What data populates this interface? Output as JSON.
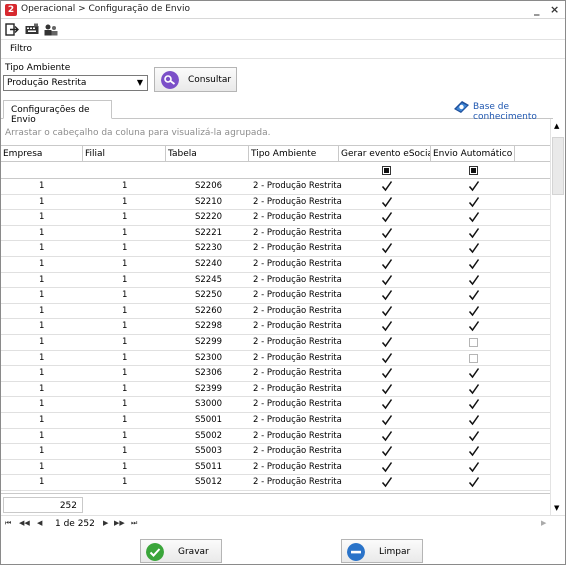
{
  "window": {
    "title": "Operacional > Configuração de Envio",
    "minimize": "_",
    "close": "×",
    "app_icon_glyph": "2"
  },
  "toolbar": {
    "icons": [
      "exit-icon",
      "keyboard-icon",
      "users-icon"
    ]
  },
  "filter": {
    "label": "Filtro",
    "tipo_ambiente_label": "Tipo Ambiente",
    "tipo_ambiente_value": "Produção Restrita",
    "consultar_label": "Consultar"
  },
  "tabs": [
    {
      "label": "Configurações de Envio",
      "active": true
    }
  ],
  "base_conhecimento": "Base de conhecimento",
  "grid": {
    "group_hint": "Arrastar o cabeçalho da coluna para visualizá-la agrupada.",
    "columns": [
      "Empresa",
      "Filial",
      "Tabela",
      "Tipo Ambiente",
      "Gerar evento eSocial",
      "Envio Automático"
    ],
    "rows": [
      {
        "empresa": "1",
        "filial": "1",
        "tabela": "S2206",
        "tipo": "2 - Produção Restrita",
        "gerar": true,
        "envio": true
      },
      {
        "empresa": "1",
        "filial": "1",
        "tabela": "S2210",
        "tipo": "2 - Produção Restrita",
        "gerar": true,
        "envio": true
      },
      {
        "empresa": "1",
        "filial": "1",
        "tabela": "S2220",
        "tipo": "2 - Produção Restrita",
        "gerar": true,
        "envio": true
      },
      {
        "empresa": "1",
        "filial": "1",
        "tabela": "S2221",
        "tipo": "2 - Produção Restrita",
        "gerar": true,
        "envio": true
      },
      {
        "empresa": "1",
        "filial": "1",
        "tabela": "S2230",
        "tipo": "2 - Produção Restrita",
        "gerar": true,
        "envio": true
      },
      {
        "empresa": "1",
        "filial": "1",
        "tabela": "S2240",
        "tipo": "2 - Produção Restrita",
        "gerar": true,
        "envio": true
      },
      {
        "empresa": "1",
        "filial": "1",
        "tabela": "S2245",
        "tipo": "2 - Produção Restrita",
        "gerar": true,
        "envio": true
      },
      {
        "empresa": "1",
        "filial": "1",
        "tabela": "S2250",
        "tipo": "2 - Produção Restrita",
        "gerar": true,
        "envio": true
      },
      {
        "empresa": "1",
        "filial": "1",
        "tabela": "S2260",
        "tipo": "2 - Produção Restrita",
        "gerar": true,
        "envio": true
      },
      {
        "empresa": "1",
        "filial": "1",
        "tabela": "S2298",
        "tipo": "2 - Produção Restrita",
        "gerar": true,
        "envio": true
      },
      {
        "empresa": "1",
        "filial": "1",
        "tabela": "S2299",
        "tipo": "2 - Produção Restrita",
        "gerar": true,
        "envio": false
      },
      {
        "empresa": "1",
        "filial": "1",
        "tabela": "S2300",
        "tipo": "2 - Produção Restrita",
        "gerar": true,
        "envio": false
      },
      {
        "empresa": "1",
        "filial": "1",
        "tabela": "S2306",
        "tipo": "2 - Produção Restrita",
        "gerar": true,
        "envio": true
      },
      {
        "empresa": "1",
        "filial": "1",
        "tabela": "S2399",
        "tipo": "2 - Produção Restrita",
        "gerar": true,
        "envio": true
      },
      {
        "empresa": "1",
        "filial": "1",
        "tabela": "S3000",
        "tipo": "2 - Produção Restrita",
        "gerar": true,
        "envio": true
      },
      {
        "empresa": "1",
        "filial": "1",
        "tabela": "S5001",
        "tipo": "2 - Produção Restrita",
        "gerar": true,
        "envio": true
      },
      {
        "empresa": "1",
        "filial": "1",
        "tabela": "S5002",
        "tipo": "2 - Produção Restrita",
        "gerar": true,
        "envio": true
      },
      {
        "empresa": "1",
        "filial": "1",
        "tabela": "S5003",
        "tipo": "2 - Produção Restrita",
        "gerar": true,
        "envio": true
      },
      {
        "empresa": "1",
        "filial": "1",
        "tabela": "S5011",
        "tipo": "2 - Produção Restrita",
        "gerar": true,
        "envio": true
      },
      {
        "empresa": "1",
        "filial": "1",
        "tabela": "S5012",
        "tipo": "2 - Produção Restrita",
        "gerar": true,
        "envio": true
      }
    ],
    "total_count": "252"
  },
  "pager": {
    "text": "1 de 252",
    "first": "⏮",
    "prev_page": "◀◀",
    "prev": "◀",
    "next": "▶",
    "next_page": "▶▶",
    "last": "⏭"
  },
  "footer": {
    "gravar_label": "Gravar",
    "limpar_label": "Limpar"
  },
  "colors": {
    "app_icon": "#d7282e",
    "link": "#1f57b0",
    "consultar_icon": "#7b4fc8",
    "gravar_icon": "#3aa53a",
    "limpar_icon": "#2a73c9"
  }
}
